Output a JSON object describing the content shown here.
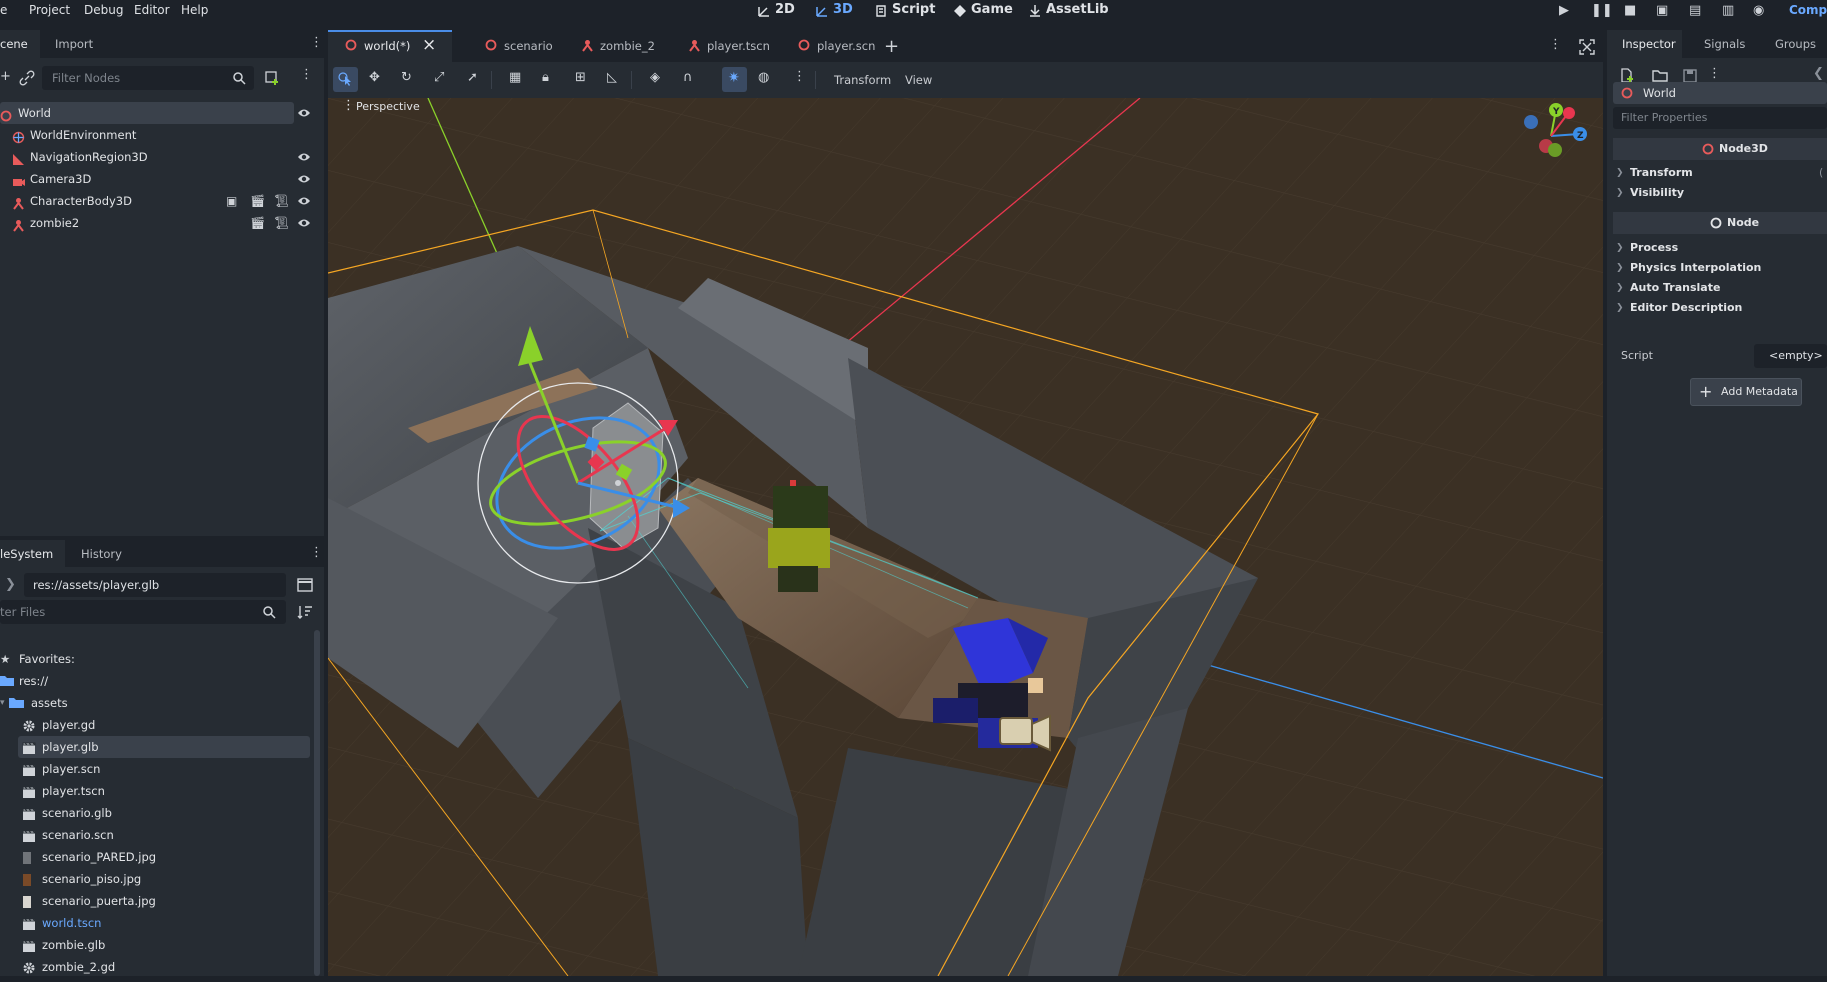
{
  "menu": {
    "items": [
      "e",
      "Project",
      "Debug",
      "Editor",
      "Help"
    ]
  },
  "workspaces": [
    {
      "icon": "2D",
      "label": "2D"
    },
    {
      "icon": "3D",
      "label": "3D"
    },
    {
      "icon": "script",
      "label": "Script"
    },
    {
      "icon": "game",
      "label": "Game"
    },
    {
      "icon": "assetlib",
      "label": "AssetLib"
    }
  ],
  "renderer_label": "Compa",
  "scene_dock": {
    "tabs": [
      "cene",
      "Import"
    ],
    "filter_placeholder": "Filter Nodes",
    "nodes": [
      {
        "name": "World",
        "icon": "node3d",
        "selected": true,
        "eye": true
      },
      {
        "name": "WorldEnvironment",
        "icon": "world-environment",
        "eye": false
      },
      {
        "name": "NavigationRegion3D",
        "icon": "navigation-region",
        "eye": true
      },
      {
        "name": "Camera3D",
        "icon": "camera",
        "eye": true
      },
      {
        "name": "CharacterBody3D",
        "icon": "character-body",
        "eye": true
      },
      {
        "name": "zombie2",
        "icon": "character-body",
        "eye": true
      }
    ]
  },
  "filesystem": {
    "tabs": [
      "leSystem",
      "History"
    ],
    "path": "res://assets/player.glb",
    "filter_placeholder": "ter Files",
    "favorites_label": "Favorites:",
    "root_label": "res://",
    "folder_label": "assets",
    "files": [
      {
        "name": "player.gd",
        "type": "gear"
      },
      {
        "name": "player.glb",
        "type": "scene",
        "selected": true
      },
      {
        "name": "player.scn",
        "type": "scene"
      },
      {
        "name": "player.tscn",
        "type": "scene"
      },
      {
        "name": "scenario.glb",
        "type": "scene"
      },
      {
        "name": "scenario.scn",
        "type": "scene"
      },
      {
        "name": "scenario_PARED.jpg",
        "type": "image"
      },
      {
        "name": "scenario_piso.jpg",
        "type": "image-wood"
      },
      {
        "name": "scenario_puerta.jpg",
        "type": "image-light"
      },
      {
        "name": "world.tscn",
        "type": "scene",
        "highlight": true
      },
      {
        "name": "zombie.glb",
        "type": "scene"
      },
      {
        "name": "zombie_2.gd",
        "type": "gear"
      }
    ]
  },
  "scene_tabs": [
    {
      "label": "world(*)",
      "active": true,
      "close": "×"
    },
    {
      "label": "scenario"
    },
    {
      "label": "zombie_2"
    },
    {
      "label": "player.tscn"
    },
    {
      "label": "player.scn"
    }
  ],
  "viewport_toolbar": {
    "transform_label": "Transform",
    "view_label": "View"
  },
  "viewport": {
    "perspective_label": "Perspective",
    "gizmo_axes": [
      "Y",
      "X",
      "Z"
    ]
  },
  "inspector": {
    "tabs": [
      "Inspector",
      "Signals",
      "Groups"
    ],
    "node_name": "World",
    "filter_placeholder": "Filter Properties",
    "class_header": "Node3D",
    "node3d_sections": [
      "Transform",
      "Visibility"
    ],
    "node_header": "Node",
    "node_sections": [
      "Process",
      "Physics Interpolation",
      "Auto Translate",
      "Editor Description"
    ],
    "script_label": "Script",
    "script_value": "<empty>",
    "add_metadata_label": "Add Metadata",
    "transform_suffix": "("
  },
  "colors": {
    "accent": "#4a8de8",
    "axis_x": "#e8364f",
    "axis_y": "#8ad12a",
    "axis_z": "#3a8ee8",
    "selection": "#f5a623",
    "node_red": "#e85b5b"
  }
}
